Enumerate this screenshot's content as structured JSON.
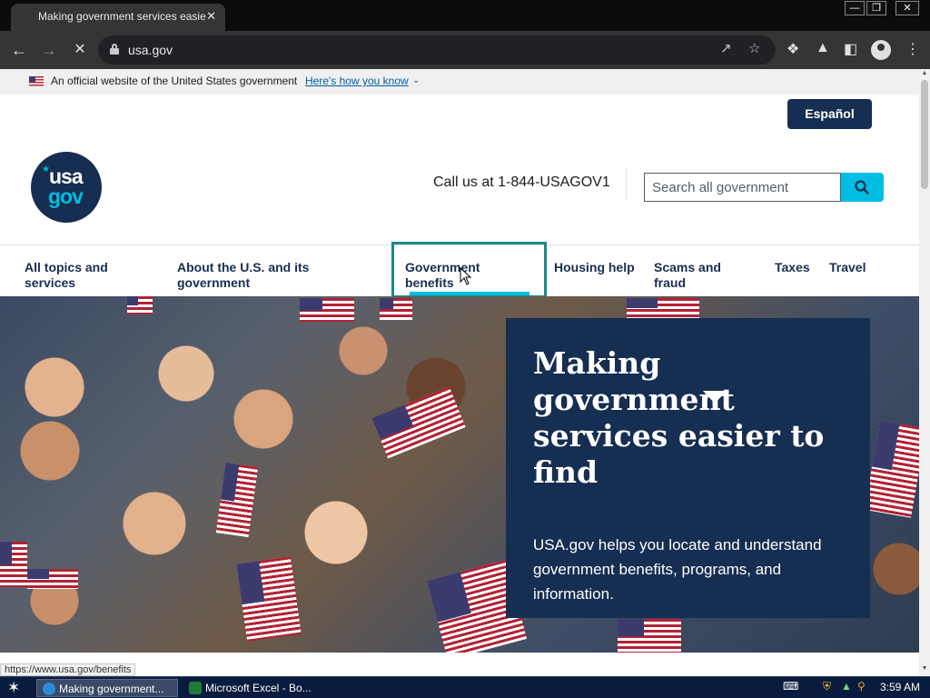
{
  "browser": {
    "tab_title": "Making government services easier to find",
    "tab_close": "✕",
    "url": "usa.gov",
    "window_controls": {
      "minimize": "—",
      "restore": "❐",
      "close": "✕"
    }
  },
  "gov_banner": {
    "text": "An official website of the United States government",
    "link": "Here's how you know",
    "chevron": "⌄"
  },
  "header": {
    "language_button": "Español",
    "logo": {
      "line1": "usa",
      "line2": "gov"
    },
    "call_us": "Call us at 1-844-USAGOV1",
    "search_placeholder": "Search all government"
  },
  "nav": {
    "items": [
      {
        "label": "All topics and services"
      },
      {
        "label": "About the U.S. and its government"
      },
      {
        "label": "Government benefits"
      },
      {
        "label": "Housing help"
      },
      {
        "label": "Scams and fraud"
      },
      {
        "label": "Taxes"
      },
      {
        "label": "Travel"
      }
    ],
    "active_index": 2
  },
  "hero": {
    "title": "Making government services easier to find",
    "description": "USA.gov helps you locate and understand government benefits, programs, and information."
  },
  "status_bar": {
    "url": "https://www.usa.gov/benefits"
  },
  "taskbar": {
    "start_icon": "star-icon",
    "items": [
      {
        "label": "Making government...",
        "active": true
      },
      {
        "label": "Microsoft Excel - Bo...",
        "active": false
      }
    ],
    "clock": "3:59 AM"
  },
  "colors": {
    "navy": "#162e51",
    "cyan": "#00bde3",
    "link_blue": "#005ea2",
    "active_outline": "#1a8a8f"
  }
}
